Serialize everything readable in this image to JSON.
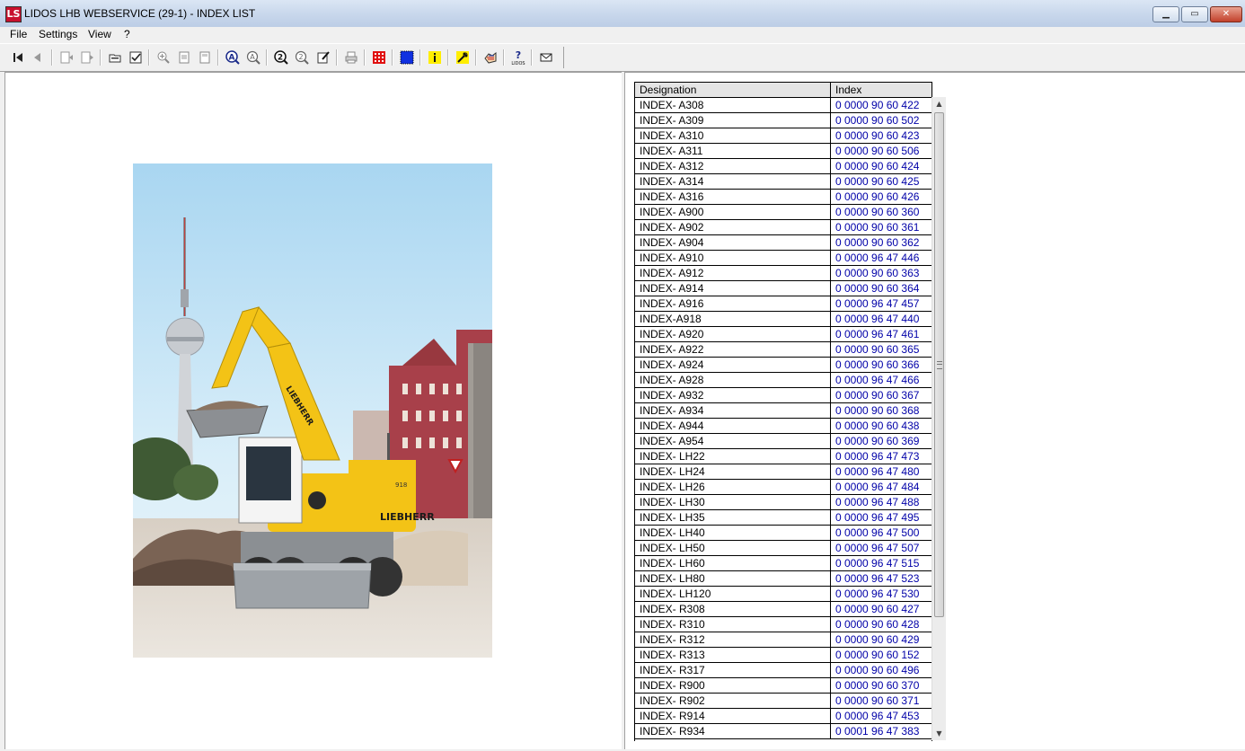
{
  "window": {
    "title": "LIDOS LHB WEBSERVICE (29-1) - INDEX LIST",
    "app_icon_glyph": "LS",
    "minimize_glyph": "▁",
    "maximize_glyph": "▭",
    "close_glyph": "✕"
  },
  "menu": [
    "File",
    "Settings",
    "View",
    "?"
  ],
  "toolbar": {
    "buttons": [
      "first-page-icon",
      "previous-page-icon",
      "back-document-icon",
      "forward-document-icon",
      "open-document-icon",
      "checklist-icon",
      "zoom-in-icon",
      "page-icon",
      "page-copy-icon",
      "search-a-icon",
      "search-next-icon",
      "help-2-icon",
      "help-next-icon",
      "edit-note-icon",
      "print-icon",
      "red-grid-icon",
      "blue-square-icon",
      "info-icon",
      "tools-icon",
      "hand-icon",
      "lidos-help-icon",
      "mail-icon"
    ],
    "accent_red": "#e01010",
    "accent_blue": "#1030e0",
    "accent_yellow": "#ffee00"
  },
  "table": {
    "headers": {
      "designation": "Designation",
      "index": "Index"
    },
    "rows": [
      {
        "designation": "INDEX- A308",
        "index": "0 0000 90 60 422"
      },
      {
        "designation": "INDEX- A309",
        "index": "0 0000 90 60 502"
      },
      {
        "designation": "INDEX- A310",
        "index": "0 0000 90 60 423"
      },
      {
        "designation": "INDEX- A311",
        "index": "0 0000 90 60 506"
      },
      {
        "designation": "INDEX- A312",
        "index": "0 0000 90 60 424"
      },
      {
        "designation": "INDEX- A314",
        "index": "0 0000 90 60 425"
      },
      {
        "designation": "INDEX- A316",
        "index": "0 0000 90 60 426"
      },
      {
        "designation": "INDEX- A900",
        "index": "0 0000 90 60 360"
      },
      {
        "designation": "INDEX- A902",
        "index": "0 0000 90 60 361"
      },
      {
        "designation": "INDEX- A904",
        "index": "0 0000 90 60 362"
      },
      {
        "designation": "INDEX- A910",
        "index": "0 0000 96 47 446"
      },
      {
        "designation": "INDEX- A912",
        "index": "0 0000 90 60 363"
      },
      {
        "designation": "INDEX- A914",
        "index": "0 0000 90 60 364"
      },
      {
        "designation": "INDEX- A916",
        "index": "0 0000 96 47 457"
      },
      {
        "designation": "INDEX-A918",
        "index": "0 0000 96 47 440"
      },
      {
        "designation": "INDEX- A920",
        "index": "0 0000 96 47 461"
      },
      {
        "designation": "INDEX- A922",
        "index": "0 0000 90 60 365"
      },
      {
        "designation": "INDEX- A924",
        "index": "0 0000 90 60 366"
      },
      {
        "designation": "INDEX- A928",
        "index": "0 0000 96 47 466"
      },
      {
        "designation": "INDEX- A932",
        "index": "0 0000 90 60 367"
      },
      {
        "designation": "INDEX- A934",
        "index": "0 0000 90 60 368"
      },
      {
        "designation": "INDEX- A944",
        "index": "0 0000 90 60 438"
      },
      {
        "designation": "INDEX- A954",
        "index": "0 0000 90 60 369"
      },
      {
        "designation": "INDEX- LH22",
        "index": "0 0000 96 47 473"
      },
      {
        "designation": "INDEX- LH24",
        "index": "0 0000 96 47 480"
      },
      {
        "designation": "INDEX- LH26",
        "index": "0 0000 96 47 484"
      },
      {
        "designation": "INDEX- LH30",
        "index": "0 0000 96 47 488"
      },
      {
        "designation": "INDEX- LH35",
        "index": "0 0000 96 47 495"
      },
      {
        "designation": "INDEX- LH40",
        "index": "0 0000 96 47 500"
      },
      {
        "designation": "INDEX- LH50",
        "index": "0 0000 96 47 507"
      },
      {
        "designation": "INDEX- LH60",
        "index": "0 0000 96 47 515"
      },
      {
        "designation": "INDEX- LH80",
        "index": "0 0000 96 47 523"
      },
      {
        "designation": "INDEX- LH120",
        "index": "0 0000 96 47 530"
      },
      {
        "designation": "INDEX- R308",
        "index": "0 0000 90 60 427"
      },
      {
        "designation": "INDEX- R310",
        "index": "0 0000 90 60 428"
      },
      {
        "designation": "INDEX- R312",
        "index": "0 0000 90 60 429"
      },
      {
        "designation": "INDEX- R313",
        "index": "0 0000 90 60 152"
      },
      {
        "designation": "INDEX- R317",
        "index": "0 0000 90 60 496"
      },
      {
        "designation": "INDEX- R900",
        "index": "0 0000 90 60 370"
      },
      {
        "designation": "INDEX- R902",
        "index": "0 0000 90 60 371"
      },
      {
        "designation": "INDEX- R914",
        "index": "0 0000 96 47 453"
      },
      {
        "designation": "INDEX- R934",
        "index": "0 0001 96 47 383"
      }
    ]
  },
  "photo": {
    "excavator_label": "LIEBHERR",
    "excavator_model": "918",
    "colors": {
      "sky": "#bfe0f5",
      "machine_yellow": "#f3c316",
      "building": "#a8404a"
    }
  },
  "scrollbar": {
    "up_glyph": "▲",
    "down_glyph": "▼"
  }
}
